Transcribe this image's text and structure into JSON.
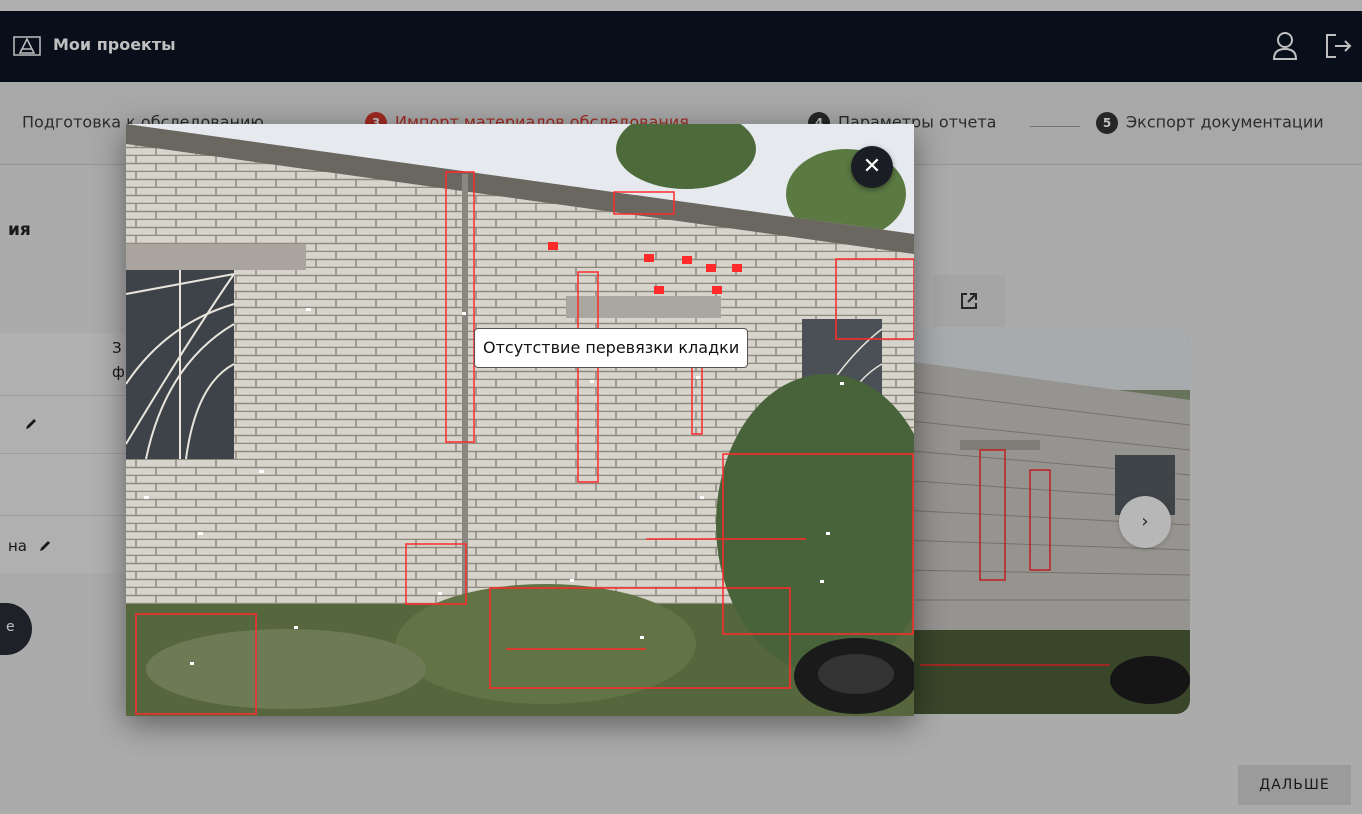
{
  "header": {
    "title": "Мои проекты",
    "icons": [
      "architecture-logo-icon",
      "user-icon",
      "logout-icon"
    ]
  },
  "steps": [
    {
      "number": "",
      "label": "Подготовка к обследованию",
      "active": false
    },
    {
      "number": "3",
      "label": "Импорт материалов обследования",
      "active": true
    },
    {
      "number": "4",
      "label": "Параметры отчета",
      "active": false
    },
    {
      "number": "5",
      "label": "Экспорт документации",
      "active": false
    }
  ],
  "main": {
    "section_title": "ия",
    "table": {
      "col_header_fragment_1": "З",
      "col_header_fragment_2": "ф",
      "rows": [
        {
          "label": ""
        },
        {
          "label": ""
        },
        {
          "label": "на"
        }
      ]
    },
    "round_button_label": "е",
    "next_button_label": "ДАЛЬШЕ"
  },
  "modal": {
    "annotation_label": "Отсутствие перевязки кладки",
    "close_icon": "close-icon"
  },
  "colors": {
    "header_bg": "#0b1424",
    "accent": "#d43a2f",
    "annotation": "#ff2a2a"
  }
}
